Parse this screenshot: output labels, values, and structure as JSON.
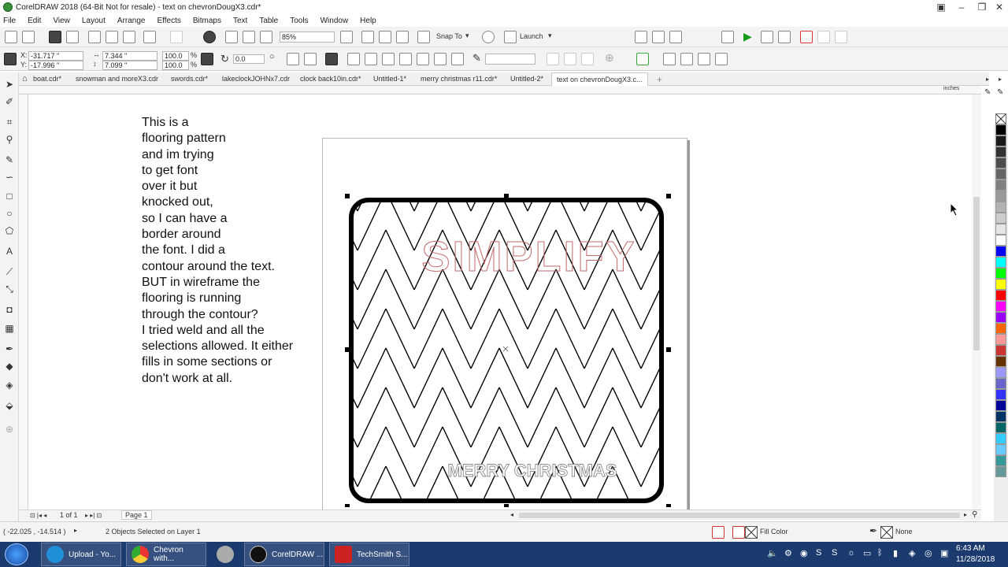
{
  "window": {
    "title": "CorelDRAW 2018 (64-Bit Not for resale) - text on chevronDougX3.cdr*"
  },
  "menu": [
    "File",
    "Edit",
    "View",
    "Layout",
    "Arrange",
    "Effects",
    "Bitmaps",
    "Text",
    "Table",
    "Tools",
    "Window",
    "Help"
  ],
  "toolbar": {
    "zoom": "85%",
    "snap_label": "Snap To",
    "launch_label": "Launch"
  },
  "properties": {
    "x": "-31.717 \"",
    "y": "-17.996 \"",
    "w": "7.344 \"",
    "h": "7.099 \"",
    "scale_x": "100.0",
    "scale_y": "100.0",
    "pct": "%",
    "rotation": "0.0"
  },
  "tabs": [
    "boat.cdr*",
    "snowman and moreX3.cdr",
    "swords.cdr*",
    "lakeclockJOHNx7.cdr",
    "clock back10in.cdr*",
    "Untitled-1*",
    "merry christmas r11.cdr*",
    "Untitled-2*",
    "text on chevronDougX3.c..."
  ],
  "active_tab": "text on chevronDougX3.c...",
  "ruler_unit": "inches",
  "note_lines": [
    "This is a",
    "flooring pattern",
    "and im trying",
    "to get font",
    "over it but",
    "knocked out,",
    "so I can have a",
    "border around",
    "the font. I did a",
    "contour around the text.",
    "BUT in wireframe the",
    "flooring is running",
    "through the contour?",
    "I tried weld and all the",
    "selections allowed. It either",
    "fills in some sections or",
    "don't work at all."
  ],
  "artwork": {
    "headline": "SIMPLIFY",
    "footer": "MERRY CHRISTMAS"
  },
  "doc_nav": {
    "page_of": "1  of  1",
    "page_name": "Page 1"
  },
  "status": {
    "coords": "( -22.025 , -14.514 )",
    "selection": "2 Objects Selected on Layer 1",
    "fill_label": "Fill Color",
    "outline_label": "None"
  },
  "taskbar": {
    "items": [
      "Upload - Yo...",
      "Chevron with...",
      "CorelDRAW ...",
      "TechSmith S..."
    ],
    "time": "6:43 AM",
    "date": "11/28/2018"
  },
  "palette_colors": [
    "#000000",
    "#1a1a1a",
    "#333333",
    "#4d4d4d",
    "#666666",
    "#808080",
    "#999999",
    "#b3b3b3",
    "#cccccc",
    "#e6e6e6",
    "#ffffff",
    "#0000ff",
    "#00ffff",
    "#00ff00",
    "#ffff00",
    "#ff0000",
    "#ff00ff",
    "#9900ff",
    "#ff6600",
    "#ff9999",
    "#cc3333",
    "#663300",
    "#9999ff",
    "#6666cc",
    "#3333ff",
    "#000099",
    "#003366",
    "#006666",
    "#33ccff",
    "#66ccff",
    "#339999",
    "#669999"
  ]
}
